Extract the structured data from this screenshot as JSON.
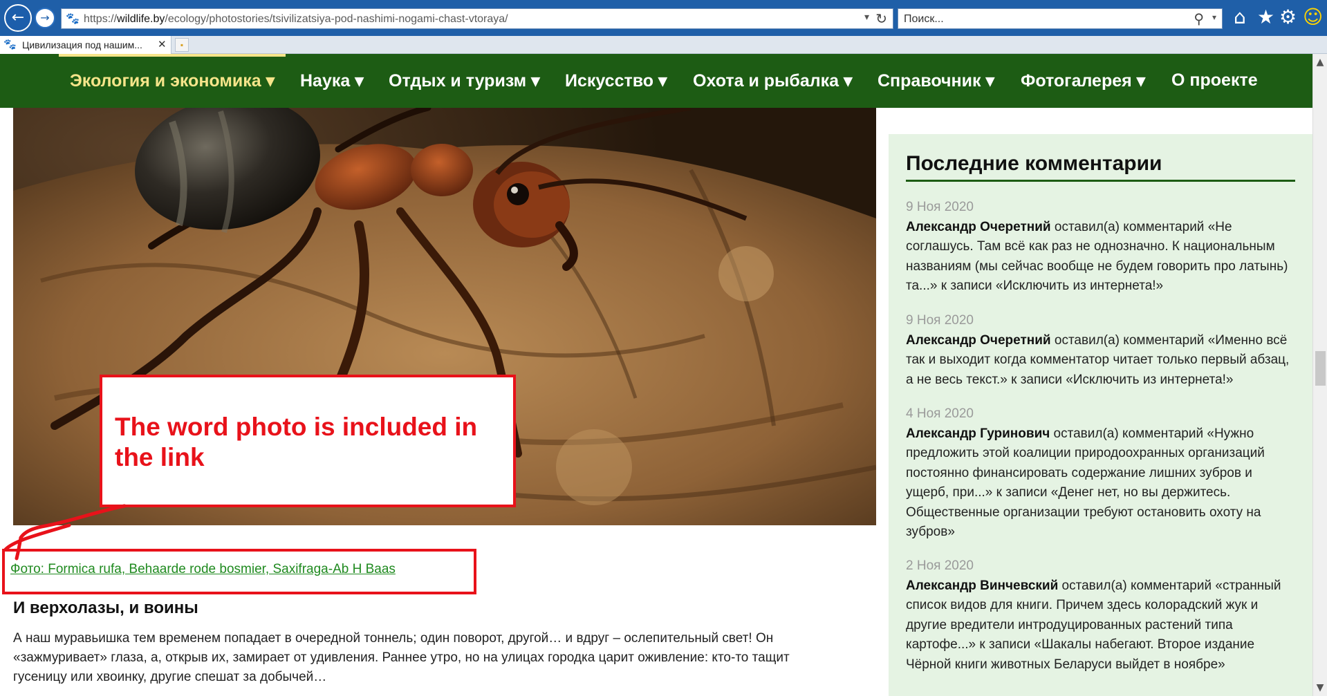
{
  "browser": {
    "url_prefix": "https://",
    "url_host": "wildlife.by",
    "url_path": "/ecology/photostories/tsivilizatsiya-pod-nashimi-nogami-chast-vtoraya/",
    "search_placeholder": "Поиск...",
    "tab_title": "Цивилизация под нашим...",
    "icons": {
      "back": "back-arrow-icon",
      "forward": "forward-arrow-icon",
      "refresh": "refresh-icon",
      "search": "search-icon",
      "home": "home-icon",
      "favorites": "star-icon",
      "settings": "gear-icon",
      "feedback": "smiley-icon",
      "tab_close": "close-icon"
    }
  },
  "nav": {
    "items": [
      {
        "label": "Экология и экономика",
        "active": true
      },
      {
        "label": "Наука",
        "active": false
      },
      {
        "label": "Отдых и туризм",
        "active": false
      },
      {
        "label": "Искусство",
        "active": false
      },
      {
        "label": "Охота и рыбалка",
        "active": false
      },
      {
        "label": "Справочник",
        "active": false
      },
      {
        "label": "Фотогалерея",
        "active": false
      },
      {
        "label": "О проекте",
        "active": false
      }
    ],
    "dropdown_glyph": "▾",
    "background": "#1d5c14",
    "active_color": "#f6e58a"
  },
  "article": {
    "callout_text": "The word photo is included in the link",
    "photo_credit_link": "Фото: Formica rufa, Behaarde rode bosmier, Saxifraga-Ab H Baas",
    "heading": "И верхолазы, и воины",
    "body": "А наш муравьишка тем временем попадает в очередной тоннель; один поворот, другой… и вдруг – ослепительный свет! Он «зажмуривает» глаза, а, открыв их, замирает от удивления. Раннее утро, но на улицах городка царит оживление: кто-то тащит гусеницу или хвоинку, другие спешат за добычей…"
  },
  "sidebar": {
    "title": "Последние комментарии",
    "comments": [
      {
        "date": "9 Ноя 2020",
        "author": "Александр Очеретний",
        "text": " оставил(а) комментарий «Не соглашусь. Там всё как раз не однозначно. К национальным названиям (мы сейчас вообще не будем говорить про латынь) та...» к записи «Исключить из интернета!»"
      },
      {
        "date": "9 Ноя 2020",
        "author": "Александр Очеретний",
        "text": " оставил(а) комментарий «Именно всё так и выходит когда комментатор читает только первый абзац, а не весь текст.» к записи «Исключить из интернета!»"
      },
      {
        "date": "4 Ноя 2020",
        "author": "Александр Гуринович",
        "text": " оставил(а) комментарий «Нужно предложить этой коалиции природоохранных организаций постоянно финансировать содержание лишних зубров и ущерб, при...» к записи «Денег нет, но вы держитесь. Общественные организации требуют остановить охоту на зубров»"
      },
      {
        "date": "2 Ноя 2020",
        "author": "Александр Винчевский",
        "text": " оставил(а) комментарий «странный список видов для книги. Причем здесь колорадский жук и другие вредители интродуцированных растений типа картофе...» к записи «Шакалы набегают. Второе издание Чёрной книги животных Беларуси выйдет в ноябре»"
      }
    ]
  },
  "colors": {
    "annotation_red": "#e8121a",
    "link_green": "#1f8a1f",
    "sidebar_bg": "#e5f3e3"
  }
}
